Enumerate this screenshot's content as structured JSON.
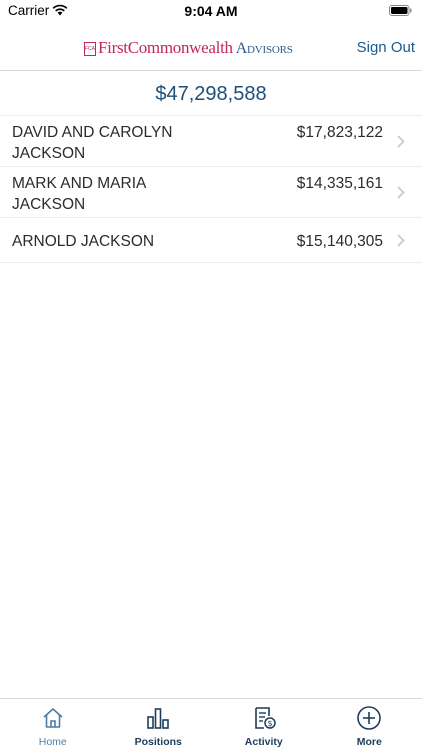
{
  "status_bar": {
    "carrier": "Carrier",
    "time": "9:04 AM"
  },
  "nav": {
    "brand_first": "First",
    "brand_common": "Commonwealth",
    "brand_advisors": "Advisors",
    "sign_out_label": "Sign Out"
  },
  "total": "$47,298,588",
  "accounts": [
    {
      "name": "DAVID AND CAROLYN JACKSON",
      "value": "$17,823,122"
    },
    {
      "name": "MARK AND MARIA JACKSON",
      "value": "$14,335,161"
    },
    {
      "name": "ARNOLD JACKSON",
      "value": "$15,140,305"
    }
  ],
  "tabs": [
    {
      "label": "Home",
      "icon": "home-icon",
      "active": true
    },
    {
      "label": "Positions",
      "icon": "bar-chart-icon",
      "active": false
    },
    {
      "label": "Activity",
      "icon": "document-dollar-icon",
      "active": false
    },
    {
      "label": "More",
      "icon": "plus-circle-icon",
      "active": false
    }
  ],
  "colors": {
    "brand_red": "#c3285c",
    "brand_blue": "#2f5a8c",
    "link_blue": "#1a5a8f",
    "total_blue": "#1d4f7a",
    "tab_active": "#4d7da8",
    "tab_inactive": "#1d3d5c"
  }
}
